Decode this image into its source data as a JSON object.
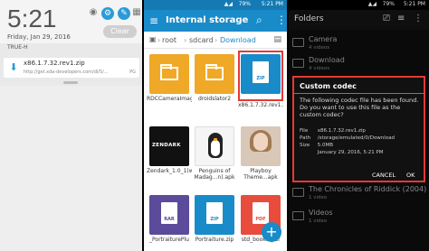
{
  "notification_panel": {
    "time": "5:21",
    "date": "Friday, Jan 29, 2016",
    "clear_label": "Clear",
    "carrier": "TRUE-H",
    "notification": {
      "title": "x86.1.7.32.rev1.zip",
      "url": "http://get.xda-developers.com/dl/5/...",
      "progress_label": "PG"
    }
  },
  "file_manager": {
    "status": {
      "signal": "▲◢",
      "battery": "79%",
      "clock": "5:21 PM"
    },
    "title": "Internal storage",
    "breadcrumb": [
      "root",
      "sdcard",
      "Download"
    ],
    "files": [
      {
        "type": "folder",
        "label": "RDCCameraImages"
      },
      {
        "type": "folder",
        "label": "droidslator2"
      },
      {
        "type": "zip",
        "label": "x86.1.7.32.rev1.zip",
        "badge": "ZIP"
      },
      {
        "type": "apk",
        "label": "Zendark_1.0_1(www.Download...",
        "thumb_text": "ZENDARK"
      },
      {
        "type": "apk",
        "label": "Penguins of Madag...n).apk"
      },
      {
        "type": "apk",
        "label": "Playboy Theme...apk"
      },
      {
        "type": "rar",
        "label": "_PortraiturePlu",
        "badge": "RAR"
      },
      {
        "type": "zip",
        "label": "Portraiture.zip",
        "badge": "ZIP"
      },
      {
        "type": "pdf",
        "label": "std_book...pdf",
        "badge": "PDF"
      }
    ],
    "fab": "+"
  },
  "video_app": {
    "status": {
      "signal": "▲◢",
      "battery": "79%",
      "clock": "5:21 PM"
    },
    "title": "Folders",
    "folders": [
      {
        "name": "Camera",
        "count": "4 videos"
      },
      {
        "name": "Download",
        "count": "4 videos"
      },
      {
        "name": "The Chronicles of Riddick (2004)",
        "count": "1 video"
      },
      {
        "name": "Videos",
        "count": "1 video"
      }
    ],
    "dialog": {
      "title": "Custom codec",
      "message": "The following codec file has been found. Do you want to use this file as the custom codec?",
      "file_key": "File",
      "file_val": "x86.1.7.32.rev1.zip",
      "path_key": "Path",
      "path_val": "/storage/emulated/0/Download",
      "size_key": "Size",
      "size_val": "5.0MB",
      "date_val": "January 29, 2016, 5:21 PM",
      "cancel": "CANCEL",
      "ok": "OK"
    }
  },
  "colors": {
    "accent_blue": "#1a8bc9",
    "folder_orange": "#f0a827",
    "highlight_red": "#e53935"
  }
}
